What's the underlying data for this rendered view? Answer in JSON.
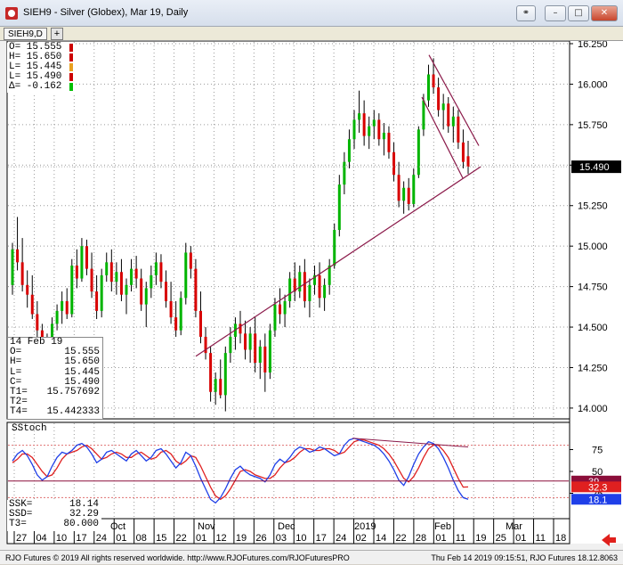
{
  "window": {
    "title": "SIEH9 - Silver (Globex), Mar 19, Daily",
    "link_icon": "chain-link-icon",
    "min_label": "–",
    "max_label": "□",
    "close_label": "✕"
  },
  "tabs": {
    "active": "SIEH9,D",
    "add_label": "+"
  },
  "ohlc": [
    {
      "label": "O= 15.555",
      "color": "#cc0000"
    },
    {
      "label": "H= 15.650",
      "color": "#cc0000"
    },
    {
      "label": "L= 15.445",
      "color": "#e8a020"
    },
    {
      "label": "L= 15.490",
      "color": "#cc0000"
    },
    {
      "label": "Δ= -0.162",
      "color": "#00c000"
    }
  ],
  "databox": {
    "date": "14 Feb 19",
    "rows": [
      {
        "k": "O=",
        "v": "15.555"
      },
      {
        "k": "H=",
        "v": "15.650"
      },
      {
        "k": "L=",
        "v": "15.445"
      },
      {
        "k": "C=",
        "v": "15.490"
      },
      {
        "k": "T1=",
        "v": "15.757692"
      },
      {
        "k": "T2=",
        "v": ""
      },
      {
        "k": "T4=",
        "v": "15.442333"
      }
    ]
  },
  "stochbox": {
    "title": "SStoch",
    "rows": [
      {
        "k": "SSK=",
        "v": "18.14"
      },
      {
        "k": "SSD=",
        "v": "32.29"
      },
      {
        "k": "T3=",
        "v": "80.000"
      }
    ]
  },
  "status": {
    "left": "RJO Futures © 2019 All rights reserved worldwide. http://www.RJOFutures.com/RJOFuturesPRO",
    "right": "Thu Feb 14 2019 09:15:51, RJO Futures 18.12.8063"
  },
  "chart_data": {
    "type": "candlestick",
    "symbol": "SIEH9",
    "timeframe": "Daily",
    "price_axis": {
      "ticks": [
        "16.250",
        "16.000",
        "15.750",
        "15.500",
        "15.250",
        "15.000",
        "14.750",
        "14.500",
        "14.250",
        "14.000"
      ],
      "range": [
        13.95,
        16.25
      ],
      "last_price": "15.490"
    },
    "stoch_axis": {
      "ticks": [
        "75",
        "50",
        "25"
      ],
      "range": [
        0,
        100
      ],
      "markers": [
        {
          "label": "39",
          "value": 39,
          "color": "#8b0e3a"
        },
        {
          "label": "32.3",
          "value": 32.3,
          "color": "#e02020"
        },
        {
          "label": "18.1",
          "value": 18.1,
          "color": "#1f3fe8"
        }
      ],
      "levels": [
        80,
        20
      ]
    },
    "x_axis": {
      "day_labels": [
        "27",
        "04",
        "10",
        "17",
        "24",
        "01",
        "08",
        "15",
        "22",
        "01",
        "12",
        "19",
        "26",
        "03",
        "10",
        "17",
        "24",
        "02",
        "14",
        "22",
        "28",
        "01",
        "11",
        "19",
        "25",
        "01",
        "11",
        "18"
      ],
      "month_labels": [
        "Oct",
        "Nov",
        "Dec",
        "2019",
        "Feb",
        "Mar"
      ]
    },
    "ohlc_bars": [
      [
        14.76,
        15.02,
        14.7,
        14.98
      ],
      [
        14.98,
        15.18,
        14.85,
        14.9
      ],
      [
        14.9,
        15.05,
        14.72,
        14.76
      ],
      [
        14.76,
        14.85,
        14.62,
        14.7
      ],
      [
        14.7,
        14.82,
        14.55,
        14.58
      ],
      [
        14.58,
        14.66,
        14.42,
        14.48
      ],
      [
        14.48,
        14.52,
        14.32,
        14.38
      ],
      [
        14.38,
        14.46,
        14.28,
        14.42
      ],
      [
        14.42,
        14.56,
        14.36,
        14.52
      ],
      [
        14.52,
        14.64,
        14.48,
        14.6
      ],
      [
        14.6,
        14.72,
        14.52,
        14.66
      ],
      [
        14.66,
        14.74,
        14.55,
        14.58
      ],
      [
        14.58,
        14.92,
        14.56,
        14.88
      ],
      [
        14.88,
        14.98,
        14.74,
        14.8
      ],
      [
        14.8,
        15.05,
        14.78,
        15.0
      ],
      [
        15.0,
        15.04,
        14.82,
        14.86
      ],
      [
        14.86,
        14.96,
        14.68,
        14.72
      ],
      [
        14.72,
        14.82,
        14.55,
        14.6
      ],
      [
        14.6,
        14.86,
        14.56,
        14.82
      ],
      [
        14.82,
        14.96,
        14.78,
        14.9
      ],
      [
        14.9,
        14.98,
        14.72,
        14.78
      ],
      [
        14.78,
        14.9,
        14.7,
        14.84
      ],
      [
        14.84,
        14.92,
        14.66,
        14.7
      ],
      [
        14.7,
        14.8,
        14.58,
        14.76
      ],
      [
        14.76,
        14.92,
        14.72,
        14.86
      ],
      [
        14.86,
        14.94,
        14.74,
        14.8
      ],
      [
        14.8,
        14.86,
        14.6,
        14.64
      ],
      [
        14.64,
        14.78,
        14.5,
        14.74
      ],
      [
        14.74,
        14.88,
        14.68,
        14.82
      ],
      [
        14.82,
        14.96,
        14.76,
        14.9
      ],
      [
        14.9,
        14.95,
        14.74,
        14.78
      ],
      [
        14.78,
        14.85,
        14.62,
        14.66
      ],
      [
        14.66,
        14.78,
        14.52,
        14.56
      ],
      [
        14.56,
        14.66,
        14.44,
        14.48
      ],
      [
        14.48,
        14.72,
        14.45,
        14.68
      ],
      [
        14.68,
        15.02,
        14.64,
        14.96
      ],
      [
        14.96,
        15.0,
        14.8,
        14.86
      ],
      [
        14.86,
        14.92,
        14.56,
        14.6
      ],
      [
        14.6,
        14.72,
        14.4,
        14.44
      ],
      [
        14.44,
        14.5,
        14.3,
        14.34
      ],
      [
        14.34,
        14.38,
        14.04,
        14.1
      ],
      [
        14.1,
        14.22,
        14.02,
        14.18
      ],
      [
        14.18,
        14.3,
        14.06,
        14.08
      ],
      [
        14.08,
        14.38,
        13.98,
        14.34
      ],
      [
        14.34,
        14.5,
        14.28,
        14.44
      ],
      [
        14.44,
        14.56,
        14.36,
        14.52
      ],
      [
        14.52,
        14.6,
        14.4,
        14.46
      ],
      [
        14.46,
        14.54,
        14.3,
        14.36
      ],
      [
        14.36,
        14.5,
        14.28,
        14.46
      ],
      [
        14.46,
        14.56,
        14.22,
        14.28
      ],
      [
        14.28,
        14.42,
        14.18,
        14.38
      ],
      [
        14.38,
        14.46,
        14.1,
        14.22
      ],
      [
        14.22,
        14.52,
        14.18,
        14.48
      ],
      [
        14.48,
        14.68,
        14.44,
        14.64
      ],
      [
        14.64,
        14.74,
        14.52,
        14.58
      ],
      [
        14.58,
        14.7,
        14.5,
        14.66
      ],
      [
        14.66,
        14.84,
        14.62,
        14.8
      ],
      [
        14.8,
        14.9,
        14.66,
        14.72
      ],
      [
        14.72,
        14.88,
        14.68,
        14.84
      ],
      [
        14.84,
        14.92,
        14.62,
        14.66
      ],
      [
        14.66,
        14.8,
        14.56,
        14.76
      ],
      [
        14.76,
        14.88,
        14.7,
        14.82
      ],
      [
        14.82,
        14.9,
        14.62,
        14.68
      ],
      [
        14.68,
        14.8,
        14.6,
        14.76
      ],
      [
        14.76,
        14.92,
        14.7,
        14.88
      ],
      [
        14.88,
        15.14,
        14.86,
        15.1
      ],
      [
        15.1,
        15.44,
        15.06,
        15.38
      ],
      [
        15.38,
        15.58,
        15.32,
        15.52
      ],
      [
        15.52,
        15.72,
        15.48,
        15.66
      ],
      [
        15.66,
        15.84,
        15.6,
        15.78
      ],
      [
        15.78,
        15.96,
        15.7,
        15.82
      ],
      [
        15.82,
        15.9,
        15.62,
        15.68
      ],
      [
        15.68,
        15.8,
        15.6,
        15.74
      ],
      [
        15.74,
        15.84,
        15.66,
        15.78
      ],
      [
        15.78,
        15.82,
        15.62,
        15.66
      ],
      [
        15.66,
        15.76,
        15.56,
        15.7
      ],
      [
        15.7,
        15.74,
        15.54,
        15.58
      ],
      [
        15.58,
        15.64,
        15.4,
        15.44
      ],
      [
        15.44,
        15.52,
        15.24,
        15.28
      ],
      [
        15.28,
        15.4,
        15.2,
        15.36
      ],
      [
        15.36,
        15.42,
        15.22,
        15.26
      ],
      [
        15.26,
        15.48,
        15.24,
        15.44
      ],
      [
        15.44,
        15.74,
        15.42,
        15.72
      ],
      [
        15.72,
        15.94,
        15.68,
        15.9
      ],
      [
        15.9,
        16.12,
        15.86,
        16.06
      ],
      [
        16.06,
        16.16,
        15.94,
        15.98
      ],
      [
        15.98,
        16.04,
        15.8,
        15.84
      ],
      [
        15.84,
        15.94,
        15.72,
        15.88
      ],
      [
        15.88,
        15.92,
        15.7,
        15.74
      ],
      [
        15.74,
        15.86,
        15.64,
        15.8
      ],
      [
        15.8,
        15.84,
        15.6,
        15.64
      ],
      [
        15.64,
        15.72,
        15.48,
        15.52
      ],
      [
        15.555,
        15.65,
        15.445,
        15.49
      ]
    ],
    "trendlines": [
      {
        "label": "support",
        "from": [
          14.32,
          0.0
        ],
        "to": [
          15.49,
          1.0
        ],
        "color": "#8b1a4a"
      },
      {
        "label": "channel-top",
        "from": [
          16.18,
          0.0
        ],
        "to": [
          15.62,
          1.0
        ],
        "color": "#8b1a4a"
      },
      {
        "label": "channel-bottom",
        "from": [
          15.92,
          0.0
        ],
        "to": [
          15.42,
          1.0
        ],
        "color": "#8b1a4a"
      }
    ],
    "stoch_k": [
      62,
      70,
      74,
      68,
      58,
      46,
      40,
      44,
      56,
      66,
      72,
      70,
      74,
      80,
      82,
      78,
      70,
      60,
      64,
      72,
      74,
      70,
      66,
      62,
      70,
      74,
      68,
      62,
      66,
      74,
      76,
      70,
      62,
      54,
      60,
      72,
      68,
      56,
      42,
      30,
      18,
      14,
      20,
      30,
      42,
      52,
      56,
      50,
      46,
      44,
      42,
      38,
      46,
      58,
      64,
      60,
      66,
      74,
      78,
      76,
      72,
      74,
      78,
      76,
      72,
      68,
      70,
      80,
      86,
      88,
      86,
      84,
      82,
      80,
      76,
      70,
      62,
      52,
      40,
      34,
      44,
      58,
      70,
      78,
      84,
      82,
      76,
      66,
      54,
      40,
      28,
      20,
      18.14
    ],
    "stoch_d": [
      60,
      64,
      70,
      70,
      66,
      58,
      50,
      44,
      46,
      54,
      64,
      70,
      72,
      74,
      78,
      80,
      76,
      70,
      64,
      66,
      70,
      72,
      70,
      66,
      66,
      70,
      72,
      68,
      64,
      66,
      72,
      74,
      70,
      62,
      58,
      62,
      68,
      66,
      56,
      44,
      32,
      22,
      18,
      22,
      30,
      40,
      50,
      52,
      50,
      46,
      44,
      42,
      42,
      46,
      54,
      60,
      62,
      66,
      72,
      76,
      76,
      74,
      74,
      76,
      76,
      74,
      70,
      72,
      78,
      84,
      86,
      86,
      84,
      82,
      80,
      76,
      70,
      62,
      52,
      42,
      38,
      44,
      54,
      66,
      76,
      80,
      80,
      74,
      66,
      54,
      42,
      32,
      32.29
    ]
  }
}
